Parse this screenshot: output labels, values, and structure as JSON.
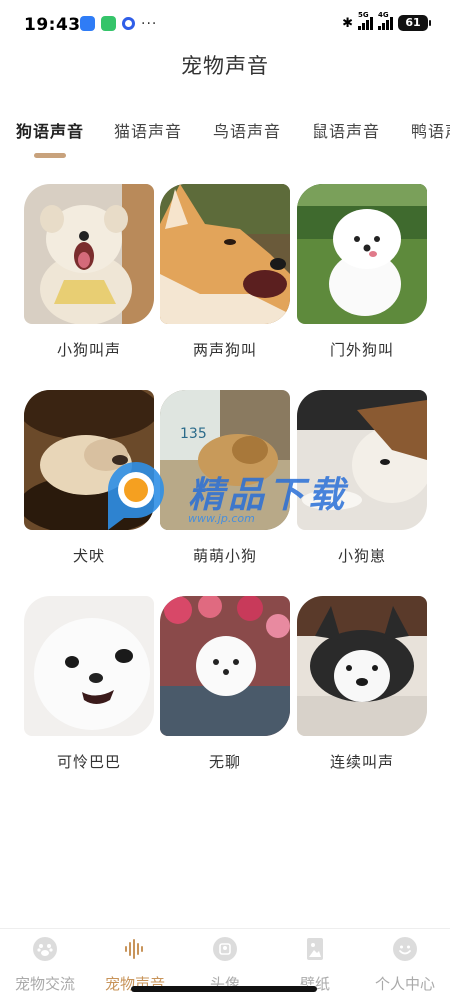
{
  "status_bar": {
    "time": "19:43",
    "left_icons": [
      "location-app-icon",
      "message-app-icon",
      "ring-app-icon"
    ],
    "dots": "···",
    "bluetooth": "✱",
    "signal1_label": "5G",
    "signal2_label": "4G",
    "battery": "61"
  },
  "page_title": "宠物声音",
  "tabs": [
    {
      "label": "狗语声音",
      "active": true
    },
    {
      "label": "猫语声音"
    },
    {
      "label": "鸟语声音"
    },
    {
      "label": "鼠语声音"
    },
    {
      "label": "鸭语声"
    }
  ],
  "accent_color": "#c8a27c",
  "active_nav_color": "#c8945a",
  "cards": [
    {
      "label": "小狗叫声",
      "image": "yawning-puppy-photo"
    },
    {
      "label": "两声狗叫",
      "image": "barking-shiba-photo"
    },
    {
      "label": "门外狗叫",
      "image": "fluffy-white-dog-on-grass-photo"
    },
    {
      "label": "犬吠",
      "image": "sleeping-puppy-photo"
    },
    {
      "label": "萌萌小狗",
      "image": "puppy-in-basket-photo"
    },
    {
      "label": "小狗崽",
      "image": "husky-lying-down-photo"
    },
    {
      "label": "可怜巴巴",
      "image": "white-pomeranian-photo"
    },
    {
      "label": "无聊",
      "image": "maltese-with-flowers-photo"
    },
    {
      "label": "连续叫声",
      "image": "husky-resting-on-floor-photo"
    }
  ],
  "watermark": {
    "text": "精品下载",
    "url": "www.jp.com"
  },
  "bottom_nav": [
    {
      "label": "宠物交流",
      "icon": "paw-icon"
    },
    {
      "label": "宠物声音",
      "icon": "sound-wave-icon",
      "active": true
    },
    {
      "label": "头像",
      "icon": "avatar-frame-icon"
    },
    {
      "label": "壁纸",
      "icon": "wallpaper-icon"
    },
    {
      "label": "个人中心",
      "icon": "smiley-face-icon"
    }
  ]
}
